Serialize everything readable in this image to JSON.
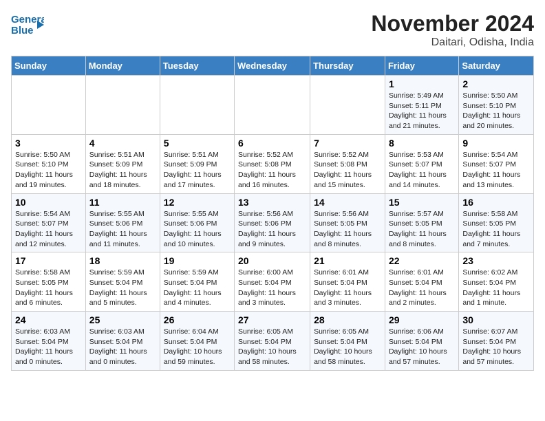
{
  "header": {
    "logo_line1": "General",
    "logo_line2": "Blue",
    "title": "November 2024",
    "subtitle": "Daitari, Odisha, India"
  },
  "days_of_week": [
    "Sunday",
    "Monday",
    "Tuesday",
    "Wednesday",
    "Thursday",
    "Friday",
    "Saturday"
  ],
  "weeks": [
    [
      {
        "day": "",
        "info": ""
      },
      {
        "day": "",
        "info": ""
      },
      {
        "day": "",
        "info": ""
      },
      {
        "day": "",
        "info": ""
      },
      {
        "day": "",
        "info": ""
      },
      {
        "day": "1",
        "info": "Sunrise: 5:49 AM\nSunset: 5:11 PM\nDaylight: 11 hours\nand 21 minutes."
      },
      {
        "day": "2",
        "info": "Sunrise: 5:50 AM\nSunset: 5:10 PM\nDaylight: 11 hours\nand 20 minutes."
      }
    ],
    [
      {
        "day": "3",
        "info": "Sunrise: 5:50 AM\nSunset: 5:10 PM\nDaylight: 11 hours\nand 19 minutes."
      },
      {
        "day": "4",
        "info": "Sunrise: 5:51 AM\nSunset: 5:09 PM\nDaylight: 11 hours\nand 18 minutes."
      },
      {
        "day": "5",
        "info": "Sunrise: 5:51 AM\nSunset: 5:09 PM\nDaylight: 11 hours\nand 17 minutes."
      },
      {
        "day": "6",
        "info": "Sunrise: 5:52 AM\nSunset: 5:08 PM\nDaylight: 11 hours\nand 16 minutes."
      },
      {
        "day": "7",
        "info": "Sunrise: 5:52 AM\nSunset: 5:08 PM\nDaylight: 11 hours\nand 15 minutes."
      },
      {
        "day": "8",
        "info": "Sunrise: 5:53 AM\nSunset: 5:07 PM\nDaylight: 11 hours\nand 14 minutes."
      },
      {
        "day": "9",
        "info": "Sunrise: 5:54 AM\nSunset: 5:07 PM\nDaylight: 11 hours\nand 13 minutes."
      }
    ],
    [
      {
        "day": "10",
        "info": "Sunrise: 5:54 AM\nSunset: 5:07 PM\nDaylight: 11 hours\nand 12 minutes."
      },
      {
        "day": "11",
        "info": "Sunrise: 5:55 AM\nSunset: 5:06 PM\nDaylight: 11 hours\nand 11 minutes."
      },
      {
        "day": "12",
        "info": "Sunrise: 5:55 AM\nSunset: 5:06 PM\nDaylight: 11 hours\nand 10 minutes."
      },
      {
        "day": "13",
        "info": "Sunrise: 5:56 AM\nSunset: 5:06 PM\nDaylight: 11 hours\nand 9 minutes."
      },
      {
        "day": "14",
        "info": "Sunrise: 5:56 AM\nSunset: 5:05 PM\nDaylight: 11 hours\nand 8 minutes."
      },
      {
        "day": "15",
        "info": "Sunrise: 5:57 AM\nSunset: 5:05 PM\nDaylight: 11 hours\nand 8 minutes."
      },
      {
        "day": "16",
        "info": "Sunrise: 5:58 AM\nSunset: 5:05 PM\nDaylight: 11 hours\nand 7 minutes."
      }
    ],
    [
      {
        "day": "17",
        "info": "Sunrise: 5:58 AM\nSunset: 5:05 PM\nDaylight: 11 hours\nand 6 minutes."
      },
      {
        "day": "18",
        "info": "Sunrise: 5:59 AM\nSunset: 5:04 PM\nDaylight: 11 hours\nand 5 minutes."
      },
      {
        "day": "19",
        "info": "Sunrise: 5:59 AM\nSunset: 5:04 PM\nDaylight: 11 hours\nand 4 minutes."
      },
      {
        "day": "20",
        "info": "Sunrise: 6:00 AM\nSunset: 5:04 PM\nDaylight: 11 hours\nand 3 minutes."
      },
      {
        "day": "21",
        "info": "Sunrise: 6:01 AM\nSunset: 5:04 PM\nDaylight: 11 hours\nand 3 minutes."
      },
      {
        "day": "22",
        "info": "Sunrise: 6:01 AM\nSunset: 5:04 PM\nDaylight: 11 hours\nand 2 minutes."
      },
      {
        "day": "23",
        "info": "Sunrise: 6:02 AM\nSunset: 5:04 PM\nDaylight: 11 hours\nand 1 minute."
      }
    ],
    [
      {
        "day": "24",
        "info": "Sunrise: 6:03 AM\nSunset: 5:04 PM\nDaylight: 11 hours\nand 0 minutes."
      },
      {
        "day": "25",
        "info": "Sunrise: 6:03 AM\nSunset: 5:04 PM\nDaylight: 11 hours\nand 0 minutes."
      },
      {
        "day": "26",
        "info": "Sunrise: 6:04 AM\nSunset: 5:04 PM\nDaylight: 10 hours\nand 59 minutes."
      },
      {
        "day": "27",
        "info": "Sunrise: 6:05 AM\nSunset: 5:04 PM\nDaylight: 10 hours\nand 58 minutes."
      },
      {
        "day": "28",
        "info": "Sunrise: 6:05 AM\nSunset: 5:04 PM\nDaylight: 10 hours\nand 58 minutes."
      },
      {
        "day": "29",
        "info": "Sunrise: 6:06 AM\nSunset: 5:04 PM\nDaylight: 10 hours\nand 57 minutes."
      },
      {
        "day": "30",
        "info": "Sunrise: 6:07 AM\nSunset: 5:04 PM\nDaylight: 10 hours\nand 57 minutes."
      }
    ]
  ]
}
